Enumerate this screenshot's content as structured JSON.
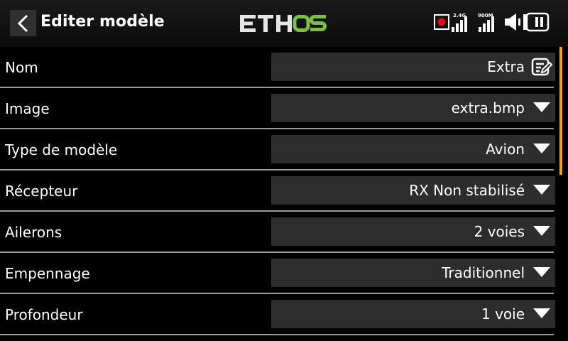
{
  "header": {
    "title": "Editer modèle",
    "logo_text": "ETHOS",
    "logo_colors": {
      "eth": "#e6e6e6",
      "os": "#7ac143"
    },
    "status": {
      "record_color": "#e01010",
      "rf1_label": "2.4G",
      "rf2_label": "900M",
      "icons": [
        "record-icon",
        "signal-2-4g-icon",
        "signal-900m-icon",
        "speaker-icon",
        "battery-icon"
      ]
    }
  },
  "rows": [
    {
      "label": "Nom",
      "value": "Extra",
      "control": "edit"
    },
    {
      "label": "Image",
      "value": "extra.bmp",
      "control": "dropdown"
    },
    {
      "label": "Type de modèle",
      "value": "Avion",
      "control": "dropdown"
    },
    {
      "label": "Récepteur",
      "value": "RX Non stabilisé",
      "control": "dropdown"
    },
    {
      "label": "Ailerons",
      "value": "2 voies",
      "control": "dropdown"
    },
    {
      "label": "Empennage",
      "value": "Traditionnel",
      "control": "dropdown"
    },
    {
      "label": "Profondeur",
      "value": "1 voie",
      "control": "dropdown"
    }
  ],
  "accent_color": "#f0a01e"
}
